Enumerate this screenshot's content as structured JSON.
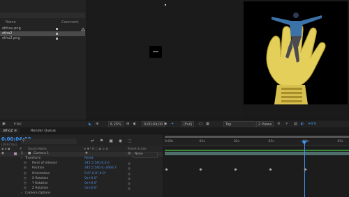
{
  "project": {
    "columns": {
      "name": "Name",
      "comment": "Comment"
    },
    "items": [
      {
        "name": "obhau.png"
      },
      {
        "name": "otho2"
      },
      {
        "name": "othu2.png"
      }
    ],
    "bpc": "8 bpc"
  },
  "viewer": {
    "zoom": "6.25%",
    "timecode": "0;00;04;00",
    "resolution": "(Full)",
    "view": "Top",
    "views": "2 Views",
    "exposure": "+0.0"
  },
  "timeline": {
    "tabs": [
      "otho2",
      "Render Queue"
    ],
    "timecode": "0;00;04;00",
    "fps": "(29.97 fps)",
    "columns": {
      "source": "Source Name",
      "parent": "Parent & Link"
    },
    "layer": {
      "index": "1",
      "name": "Camera 1",
      "parent": "None"
    },
    "rows": [
      {
        "label": "Transform",
        "value": "Reset",
        "indent": 1
      },
      {
        "label": "Point of Interest",
        "value": "345.5,540.0,0.0",
        "indent": 2
      },
      {
        "label": "Position",
        "value": "345.5,540.0,-2666.7",
        "indent": 2
      },
      {
        "label": "Orientation",
        "value": "0.0°,0.0°,0.0°",
        "indent": 2
      },
      {
        "label": "X Rotation",
        "value": "0x+0.0°",
        "indent": 2
      },
      {
        "label": "Y Rotation",
        "value": "0x+0.0°",
        "indent": 2
      },
      {
        "label": "Z Rotation",
        "value": "0x+0.0°",
        "indent": 2
      },
      {
        "label": "Camera Options",
        "value": "",
        "indent": 1
      }
    ],
    "ruler": [
      "0:00s",
      "01s",
      "02s",
      "03s",
      "04s",
      "05s"
    ]
  },
  "colors": {
    "accent": "#3d94f6",
    "panel": "#232323"
  }
}
